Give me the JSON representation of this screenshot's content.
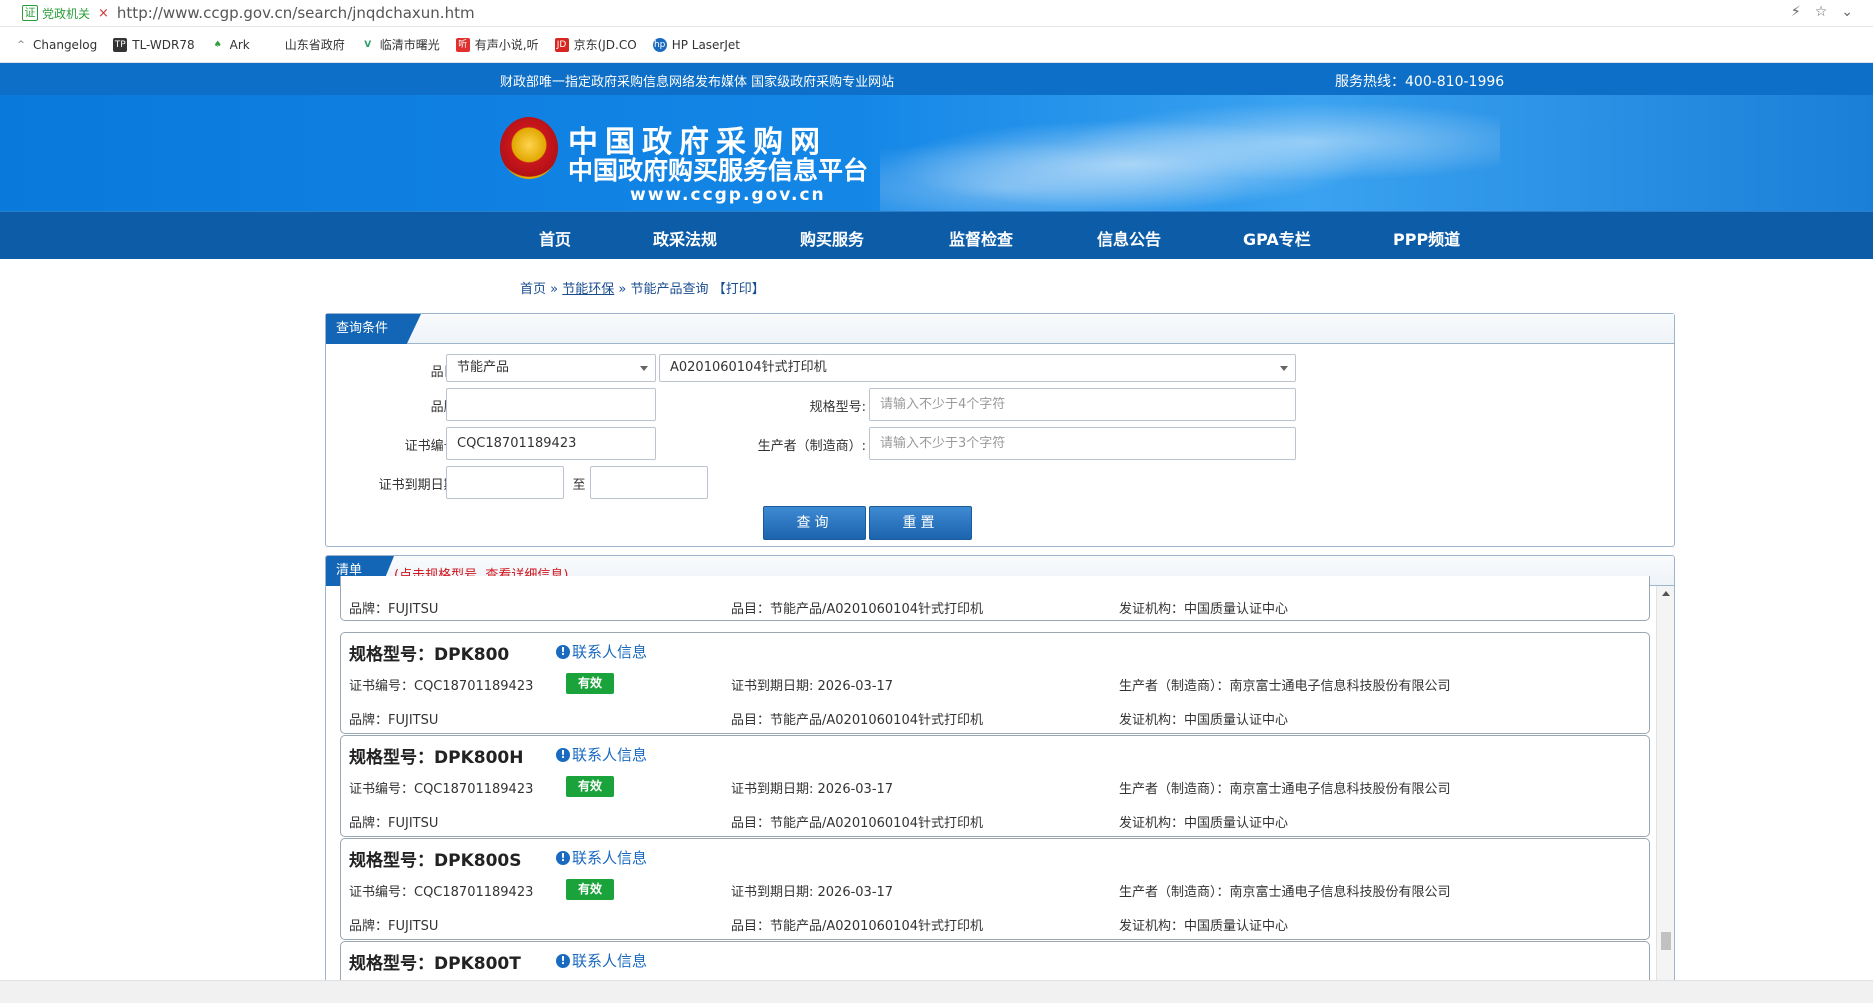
{
  "browser": {
    "badge_char": "证",
    "badge_label": "党政机关",
    "insecure_icon": "×",
    "url": "http://www.ccgp.gov.cn/search/jnqdchaxun.htm",
    "actions": [
      "⚡",
      "☆",
      "⌄"
    ],
    "bookmarks": [
      {
        "icon": "^",
        "label": "Changelog",
        "color": "#666666"
      },
      {
        "icon": "TP",
        "label": "TL-WDR78",
        "color": "#333333"
      },
      {
        "icon": "♠",
        "label": "Ark",
        "color": "#2e9e3a"
      },
      {
        "icon": "",
        "label": "山东省政府",
        "color": "#ffffff"
      },
      {
        "icon": "V",
        "label": "临清市曙光",
        "color": "#2a9d6a"
      },
      {
        "icon": "听",
        "label": "有声小说,听",
        "color": "#e0312f"
      },
      {
        "icon": "JD",
        "label": "京东(JD.CO",
        "color": "#d7261f"
      },
      {
        "icon": "hp",
        "label": "HP LaserJet",
        "color": "#1a6ac0"
      }
    ]
  },
  "header": {
    "slogan": "财政部唯一指定政府采购信息网络发布媒体 国家级政府采购专业网站",
    "hotline": "服务热线：400-810-1996",
    "title_line1": "中国政府采购网",
    "title_line2": "中国政府购买服务信息平台",
    "domain": "www.ccgp.gov.cn"
  },
  "nav": [
    "首页",
    "政采法规",
    "购买服务",
    "监督检查",
    "信息公告",
    "GPA专栏",
    "PPP频道"
  ],
  "breadcrumb": {
    "home": "首页",
    "sep": "»",
    "section": "节能环保",
    "current": "节能产品查询",
    "print": "【打印】"
  },
  "query": {
    "tab": "查询条件",
    "category_label": "品目:",
    "category_value": "节能产品",
    "subcategory_value": "A0201060104针式打印机",
    "brand_label": "品牌:",
    "brand_value": "",
    "model_label": "规格型号:",
    "model_placeholder": "请输入不少于4个字符",
    "cert_label": "证书编号:",
    "cert_value": "CQC18701189423",
    "maker_label": "生产者（制造商）:",
    "maker_placeholder": "请输入不少于3个字符",
    "expiry_label": "证书到期日期:",
    "expiry_sep": "至",
    "search_button": "查询",
    "reset_button": "重置"
  },
  "list": {
    "tab": "清单",
    "hint": "(点击规格型号, 查看详细信息)",
    "contact_label": "联系人信息",
    "partial_card": {
      "brand": "品牌：FUJITSU",
      "category": "品目：节能产品/A0201060104针式打印机",
      "issuer": "发证机构：中国质量认证中心"
    },
    "cards": [
      {
        "model": "规格型号：DPK800",
        "cert": "证书编号：CQC18701189423",
        "status": "有效",
        "expiry": "证书到期日期: 2026-03-17",
        "maker": "生产者（制造商）：南京富士通电子信息科技股份有限公司",
        "brand": "品牌：FUJITSU",
        "category": "品目：节能产品/A0201060104针式打印机",
        "issuer": "发证机构：中国质量认证中心"
      },
      {
        "model": "规格型号：DPK800H",
        "cert": "证书编号：CQC18701189423",
        "status": "有效",
        "expiry": "证书到期日期: 2026-03-17",
        "maker": "生产者（制造商）：南京富士通电子信息科技股份有限公司",
        "brand": "品牌：FUJITSU",
        "category": "品目：节能产品/A0201060104针式打印机",
        "issuer": "发证机构：中国质量认证中心"
      },
      {
        "model": "规格型号：DPK800S",
        "cert": "证书编号：CQC18701189423",
        "status": "有效",
        "expiry": "证书到期日期: 2026-03-17",
        "maker": "生产者（制造商）：南京富士通电子信息科技股份有限公司",
        "brand": "品牌：FUJITSU",
        "category": "品目：节能产品/A0201060104针式打印机",
        "issuer": "发证机构：中国质量认证中心"
      },
      {
        "model": "规格型号：DPK800T"
      }
    ]
  },
  "colors": {
    "brand_blue": "#0d6fc7",
    "nav_blue": "#0c5ca8",
    "valid_green": "#1aa33a",
    "hint_red": "#d0161c"
  }
}
